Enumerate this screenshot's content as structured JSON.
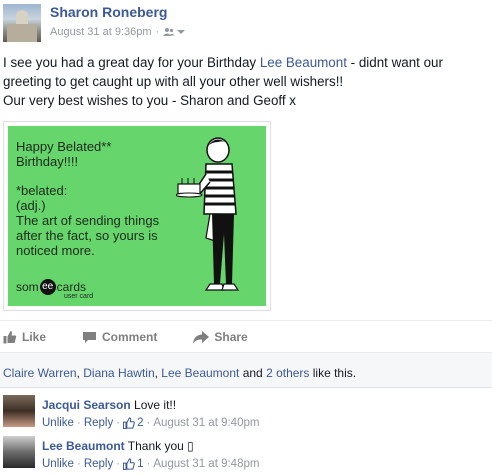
{
  "post": {
    "author": "Sharon Roneberg",
    "timestamp": "August 31 at 9:36pm",
    "separator": "·",
    "audience_icon": "friends-icon",
    "text_part1": "I see you had a great day for your Birthday ",
    "text_link": "Lee Beaumont",
    "text_part2": " - didnt want our greeting to get caught up with all your other well wishers!!",
    "text_line2": "Our very best wishes to you - Sharon and Geoff x"
  },
  "ecard": {
    "title": "Happy Belated** Birthday!!!!",
    "line1": "*belated:",
    "line2": "(adj.)",
    "line3": "The art of sending things",
    "line4": "after the fact, so yours is",
    "line5": "noticed more.",
    "logo_pre": "som",
    "logo_mid": "ee",
    "logo_post": "cards",
    "logo_sub": "user card",
    "bg_color": "#66d56b"
  },
  "actions": {
    "like": "Like",
    "comment": "Comment",
    "share": "Share"
  },
  "likes": {
    "name1": "Claire Warren",
    "sep1": ", ",
    "name2": "Diana Hawtin",
    "sep2": ", ",
    "name3": "Lee Beaumont",
    "and": " and ",
    "others": "2 others",
    "suffix": " like this."
  },
  "comments": [
    {
      "name": "Jacqui Searson",
      "text": " Love it!!",
      "unlike": "Unlike",
      "dot": "·",
      "reply": "Reply",
      "like_count": "2",
      "time": "August 31 at 9:40pm"
    },
    {
      "name": "Lee Beaumont",
      "text": " Thank you ▯",
      "unlike": "Unlike",
      "dot": "·",
      "reply": "Reply",
      "like_count": "1",
      "time": "August 31 at 9:48pm"
    }
  ],
  "colors": {
    "link": "#3b5998",
    "meta": "#9197a3",
    "text": "#141823"
  }
}
